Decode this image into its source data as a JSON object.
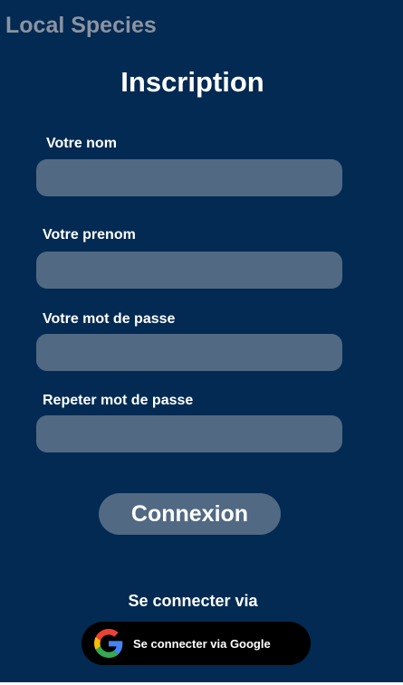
{
  "app": {
    "title": "Local Species"
  },
  "page": {
    "title": "Inscription"
  },
  "form": {
    "nom_label": "Votre nom",
    "nom_value": "",
    "prenom_label": "Votre prenom",
    "prenom_value": "",
    "password_label": "Votre mot de passe",
    "password_value": "",
    "repeat_label": "Repeter mot de passe",
    "repeat_value": ""
  },
  "actions": {
    "connexion_label": "Connexion",
    "via_label": "Se connecter via",
    "google_label": "Se connecter via Google"
  },
  "colors": {
    "background": "#022a52",
    "field": "#516983",
    "app_title": "#8b93a1",
    "google_button": "#000000"
  },
  "icons": {
    "google": "google-g-icon"
  }
}
